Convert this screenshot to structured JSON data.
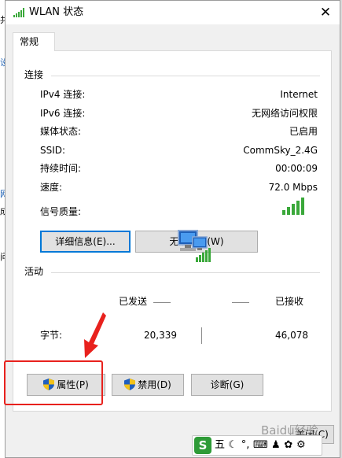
{
  "background": {
    "fragments": [
      "共",
      "设",
      "网",
      "成",
      "问"
    ]
  },
  "window": {
    "title": "WLAN 状态",
    "close_glyph": "✕"
  },
  "tabs": [
    {
      "label": "常规"
    }
  ],
  "connection": {
    "section_title": "连接",
    "rows": [
      {
        "label": "IPv4 连接:",
        "value": "Internet"
      },
      {
        "label": "IPv6 连接:",
        "value": "无网络访问权限"
      },
      {
        "label": "媒体状态:",
        "value": "已启用"
      },
      {
        "label": "SSID:",
        "value": "CommSky_2.4G"
      },
      {
        "label": "持续时间:",
        "value": "00:00:09"
      },
      {
        "label": "速度:",
        "value": "72.0 Mbps"
      }
    ],
    "signal_label": "信号质量:",
    "signal_bars_filled": 5,
    "signal_bars_total": 5,
    "details_button": "详细信息(E)...",
    "wireless_props_button": "无线属性(W)"
  },
  "activity": {
    "section_title": "活动",
    "sent_label": "已发送",
    "received_label": "已接收",
    "bytes_label": "字节:",
    "bytes_sent": "20,339",
    "bytes_received": "46,078"
  },
  "buttons": {
    "properties": "属性(P)",
    "disable": "禁用(D)",
    "diagnose": "诊断(G)",
    "close_partial": "关闭(C)"
  },
  "ime": {
    "logo": "S",
    "items": [
      "五",
      "☾",
      "°,",
      "⌨",
      "♟",
      "✿",
      "⚙"
    ]
  },
  "watermark": "Baidu经验",
  "colors": {
    "accent": "#0078d7",
    "signal": "#3aa83a",
    "highlight_frame": "#e8211d",
    "shield_blue": "#1f5fbf",
    "shield_yellow": "#f2c21b"
  },
  "icons": {
    "title": "wifi-signal-icon",
    "shield": "uac-shield-icon",
    "network": "network-computers-icon",
    "signal": "signal-strength-icon"
  }
}
